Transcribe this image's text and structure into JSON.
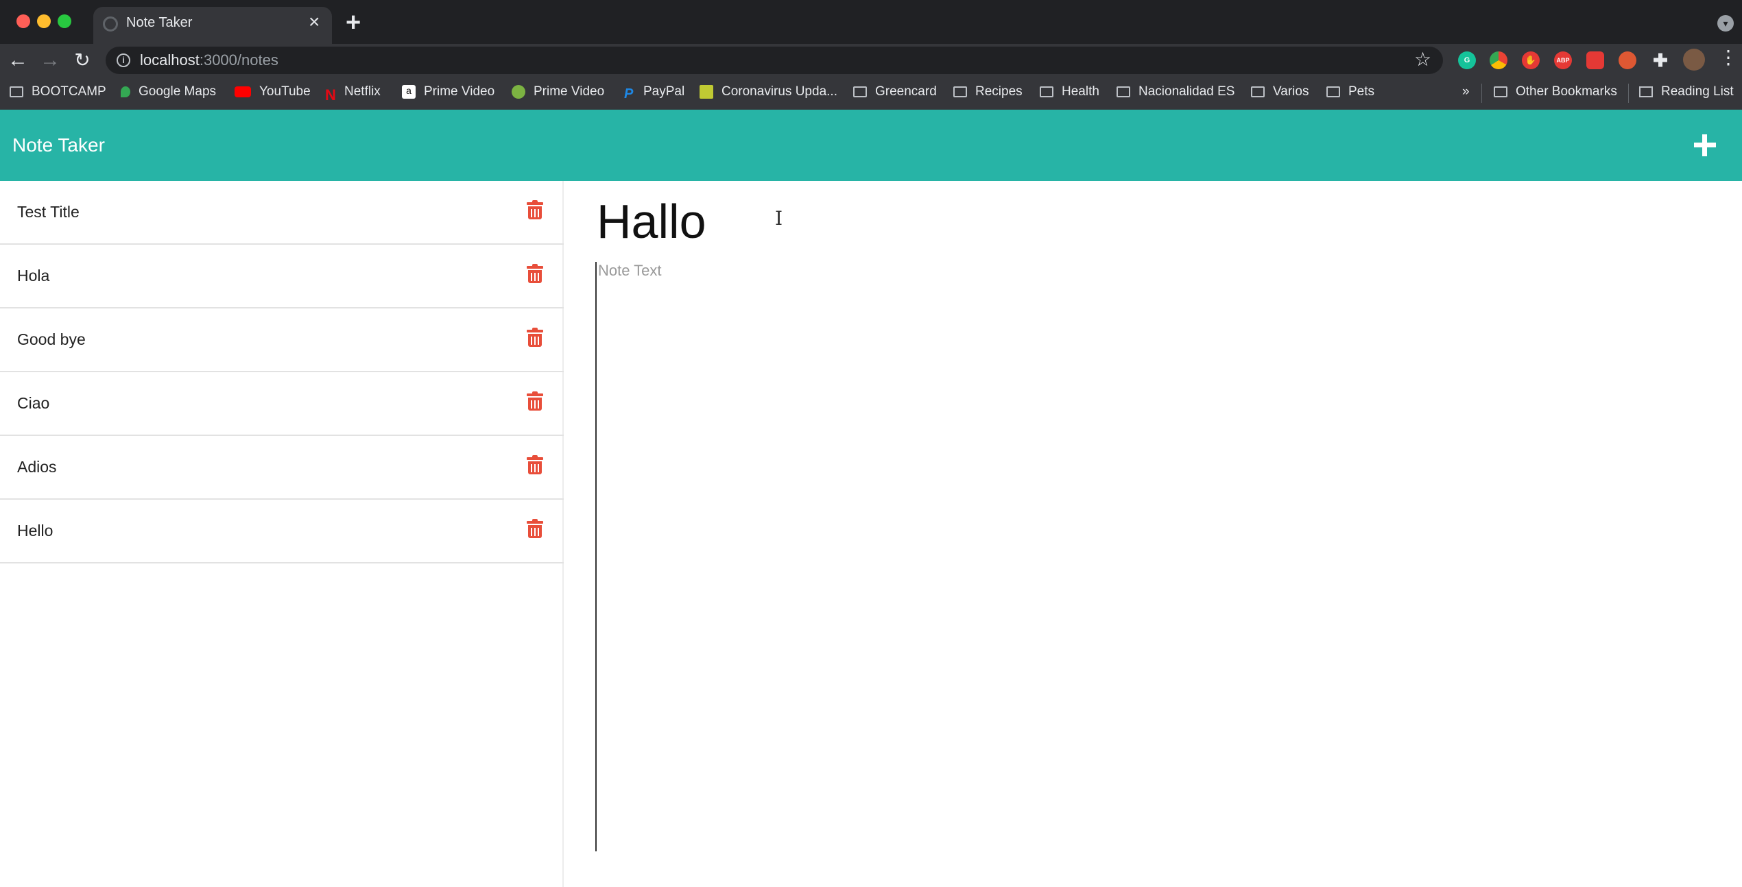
{
  "browser": {
    "tab_title": "Note Taker",
    "url_host": "localhost",
    "url_path": ":3000/notes",
    "bookmarks": [
      {
        "label": "BOOTCAMP",
        "icon": "folder-icon"
      },
      {
        "label": "Google Maps",
        "icon": "google-maps-icon"
      },
      {
        "label": "YouTube",
        "icon": "youtube-icon"
      },
      {
        "label": "Netflix",
        "icon": "netflix-icon"
      },
      {
        "label": "Prime Video",
        "icon": "amazon-icon"
      },
      {
        "label": "Prime Video",
        "icon": "prime-video-icon"
      },
      {
        "label": "PayPal",
        "icon": "paypal-icon"
      },
      {
        "label": "Coronavirus Upda...",
        "icon": "worldometer-icon"
      },
      {
        "label": "Greencard",
        "icon": "folder-icon"
      },
      {
        "label": "Recipes",
        "icon": "folder-icon"
      },
      {
        "label": "Health",
        "icon": "folder-icon"
      },
      {
        "label": "Nacionalidad ES",
        "icon": "folder-icon"
      },
      {
        "label": "Varios",
        "icon": "folder-icon"
      },
      {
        "label": "Pets",
        "icon": "folder-icon"
      }
    ],
    "overflow_label": "»",
    "other_bookmarks": "Other Bookmarks",
    "reading_list": "Reading List",
    "extensions": [
      {
        "icon": "grammarly-icon",
        "text": "G",
        "color": "#15c39a"
      },
      {
        "icon": "chrome-extension-icon",
        "text": "",
        "color": "#fbbc04"
      },
      {
        "icon": "adblock-icon",
        "text": "✋",
        "color": "#e53935"
      },
      {
        "icon": "abp-icon",
        "text": "ABP",
        "color": "#e53935"
      },
      {
        "icon": "cast-extension-icon",
        "text": "",
        "color": "#e53935"
      },
      {
        "icon": "duckduckgo-icon",
        "text": "",
        "color": "#de5833"
      }
    ]
  },
  "app": {
    "title": "Note Taker",
    "header_color": "#27b4a6",
    "trash_color": "#e84e3a"
  },
  "notes": [
    {
      "title": "Test Title"
    },
    {
      "title": "Hola"
    },
    {
      "title": "Good bye"
    },
    {
      "title": "Ciao"
    },
    {
      "title": "Adios"
    },
    {
      "title": "Hello"
    }
  ],
  "editor": {
    "title_value": "Hallo",
    "text_value": "",
    "text_placeholder": "Note Text"
  }
}
